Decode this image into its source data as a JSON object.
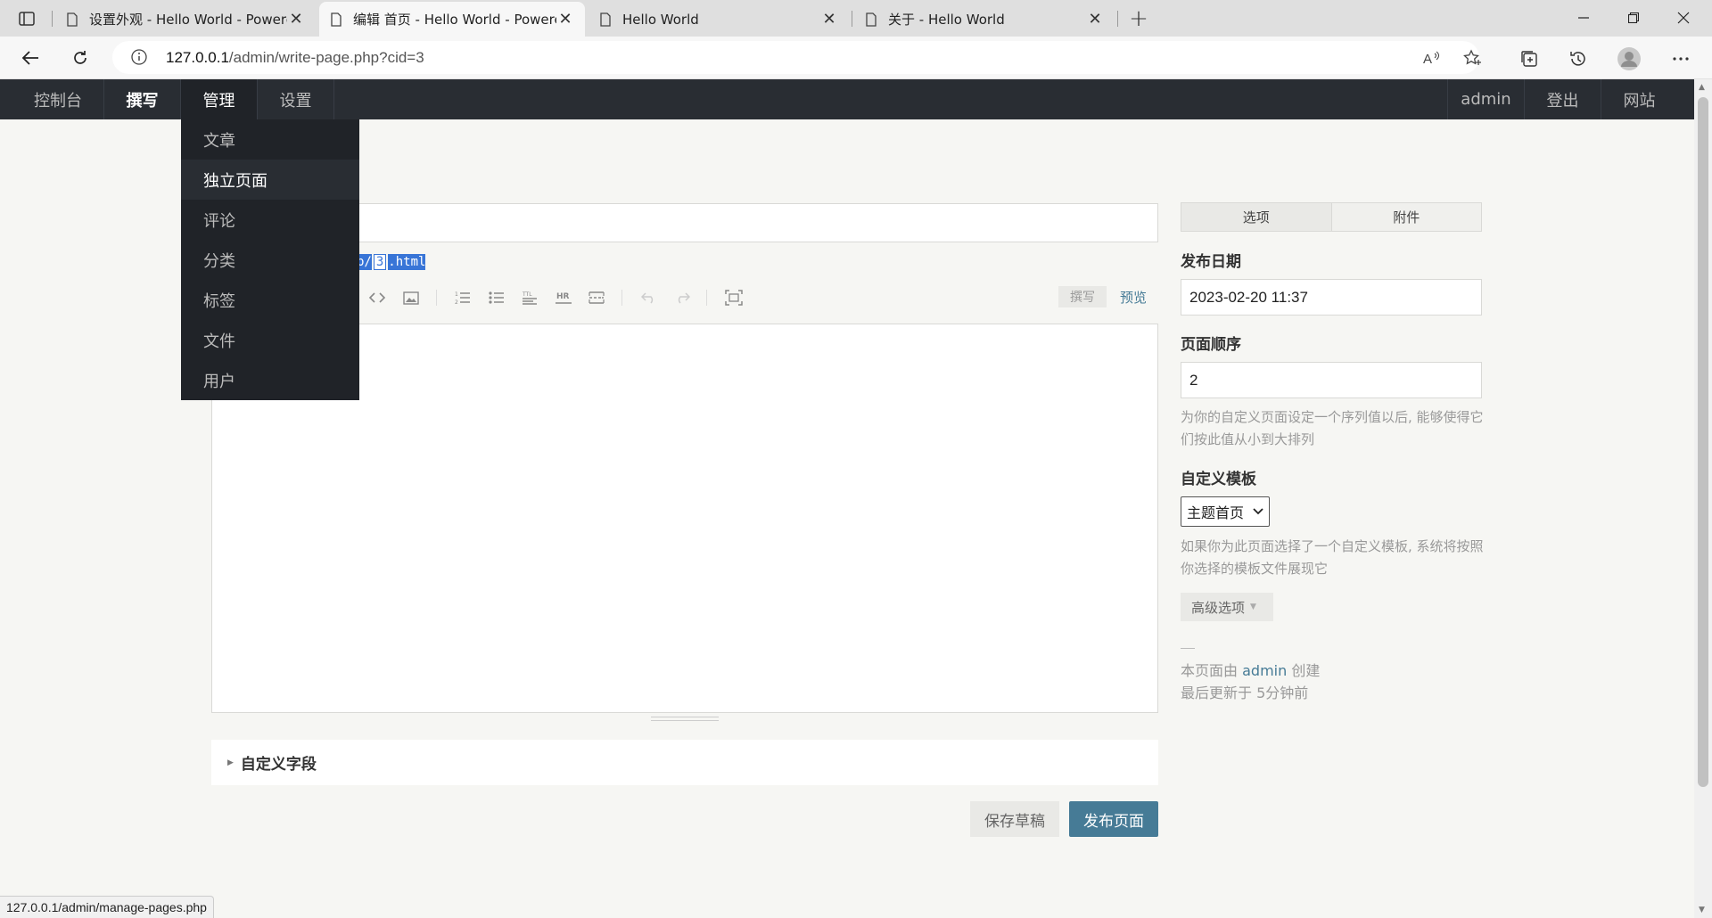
{
  "browser": {
    "tabs": [
      {
        "title": "设置外观 - Hello World - Powere"
      },
      {
        "title": "编辑 首页 - Hello World - Powere"
      },
      {
        "title": "Hello World"
      },
      {
        "title": "关于 - Hello World"
      }
    ],
    "url_host": "127.0.0.1",
    "url_path": "/admin/write-page.php?cid=3",
    "status_url": "127.0.0.1/admin/manage-pages.php"
  },
  "admin_nav": {
    "left": [
      "控制台",
      "撰写",
      "管理",
      "设置"
    ],
    "right": [
      "admin",
      "登出",
      "网站"
    ]
  },
  "manage_menu": [
    "文章",
    "独立页面",
    "评论",
    "分类",
    "标签",
    "文件",
    "用户"
  ],
  "editor": {
    "slug_prefix": "p/",
    "slug_value": "3",
    "slug_suffix": ".html",
    "mode_write": "撰写",
    "mode_preview": "预览",
    "custom_fields": "自定义字段",
    "save_draft": "保存草稿",
    "publish": "发布页面"
  },
  "sidebar": {
    "tab_options": "选项",
    "tab_attachments": "附件",
    "date_label": "发布日期",
    "date_value": "2023-02-20 11:37",
    "order_label": "页面顺序",
    "order_value": "2",
    "order_desc": "为你的自定义页面设定一个序列值以后, 能够使得它们按此值从小到大排列",
    "template_label": "自定义模板",
    "template_value": "主题首页",
    "template_desc": "如果你为此页面选择了一个自定义模板, 系统将按照你选择的模板文件展现它",
    "advanced": "高级选项",
    "created_by_prefix": "本页面由",
    "created_by_user": "admin",
    "created_by_suffix": "创建",
    "last_updated": "最后更新于 5分钟前"
  },
  "colors": {
    "accent": "#467b96",
    "nav_bg": "#292d33",
    "selection": "#3875d7"
  }
}
